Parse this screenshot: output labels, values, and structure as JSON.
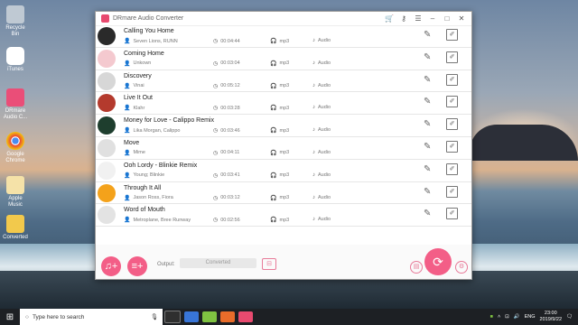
{
  "desktop": {
    "icons": [
      {
        "label": "Recycle Bin",
        "icon": "recycle-bin-icon"
      },
      {
        "label": "iTunes",
        "icon": "itunes-icon"
      },
      {
        "label": "DRmare Audio C...",
        "icon": "drmare-icon"
      },
      {
        "label": "Google Chrome",
        "icon": "chrome-icon"
      },
      {
        "label": "Apple Music",
        "icon": "apple-music-icon"
      },
      {
        "label": "Converted",
        "icon": "folder-icon"
      }
    ]
  },
  "window": {
    "title": "DRmare Audio Converter"
  },
  "tracks": [
    {
      "title": "Calling You Home",
      "artist": "Seven Lions, RUNN",
      "duration": "00:04:44",
      "format": "mp3",
      "type": "Audio",
      "color": "#2a2a2a"
    },
    {
      "title": "Coming Home",
      "artist": "Unkown",
      "duration": "00:03:04",
      "format": "mp3",
      "type": "Audio",
      "color": "#f4c9cf"
    },
    {
      "title": "Discovery",
      "artist": "Vinai",
      "duration": "00:05:12",
      "format": "mp3",
      "type": "Audio",
      "color": "#d7d7d7"
    },
    {
      "title": "Live It Out",
      "artist": "Klahr",
      "duration": "00:03:28",
      "format": "mp3",
      "type": "Audio",
      "color": "#b43a2d"
    },
    {
      "title": "Money for Love - Calippo Remix",
      "artist": "Lika Morgan, Calippo",
      "duration": "00:03:46",
      "format": "mp3",
      "type": "Audio",
      "color": "#1e3e2e"
    },
    {
      "title": "Move",
      "artist": "Mime",
      "duration": "00:04:11",
      "format": "mp3",
      "type": "Audio",
      "color": "#e0e0e0"
    },
    {
      "title": "Ooh Lordy - Blinkie Remix",
      "artist": "Young; Blinkie",
      "duration": "00:03:41",
      "format": "mp3",
      "type": "Audio",
      "color": "#f1f1f1"
    },
    {
      "title": "Through It All",
      "artist": "Jason Ross, Fiora",
      "duration": "00:03:12",
      "format": "mp3",
      "type": "Audio",
      "color": "#f4a21b"
    },
    {
      "title": "Word of Mouth",
      "artist": "Metroplane, Bree Runway",
      "duration": "00:02:56",
      "format": "mp3",
      "type": "Audio",
      "color": "#e3e3e3"
    }
  ],
  "bottom": {
    "output_label": "Output:",
    "output_value": "Converted"
  },
  "taskbar": {
    "search_placeholder": "Type here to search",
    "lang": "ENG",
    "time": "23:00",
    "date": "2019/9/22"
  },
  "colors": {
    "accent": "#f35e87"
  }
}
